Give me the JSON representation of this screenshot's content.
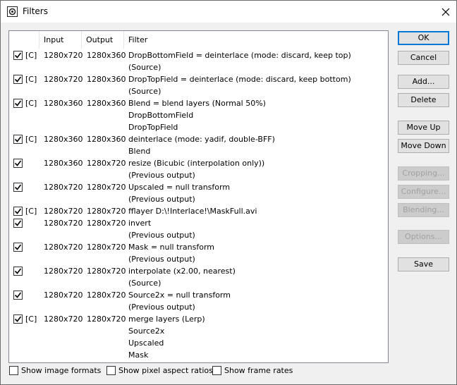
{
  "window": {
    "title": "Filters"
  },
  "columns": {
    "input": "Input",
    "output": "Output",
    "filter": "Filter"
  },
  "rows": [
    {
      "checked": true,
      "tag": "[C]",
      "input": "1280x720",
      "output": "1280x360",
      "lines": [
        "DropBottomField = deinterlace (mode: discard, keep top)",
        "(Source)"
      ]
    },
    {
      "checked": true,
      "tag": "[C]",
      "input": "1280x720",
      "output": "1280x360",
      "lines": [
        "DropTopField = deinterlace (mode: discard, keep bottom)",
        "(Source)"
      ]
    },
    {
      "checked": true,
      "tag": "[C]",
      "input": "1280x360",
      "output": "1280x360",
      "lines": [
        "Blend = blend layers (Normal 50%)",
        "DropBottomField",
        "DropTopField"
      ]
    },
    {
      "checked": true,
      "tag": "[C]",
      "input": "1280x360",
      "output": "1280x360",
      "lines": [
        "deinterlace (mode: yadif, double-BFF)",
        "Blend"
      ]
    },
    {
      "checked": true,
      "tag": "",
      "input": "1280x360",
      "output": "1280x720",
      "lines": [
        "resize (Bicubic (interpolation only))",
        "(Previous output)"
      ]
    },
    {
      "checked": true,
      "tag": "",
      "input": "1280x720",
      "output": "1280x720",
      "lines": [
        "Upscaled = null transform",
        "(Previous output)"
      ]
    },
    {
      "checked": true,
      "tag": "[C]",
      "input": "1280x720",
      "output": "1280x720",
      "lines": [
        "fflayer D:\\!Interlace!\\MaskFull.avi"
      ]
    },
    {
      "checked": true,
      "tag": "",
      "input": "1280x720",
      "output": "1280x720",
      "lines": [
        "invert",
        "(Previous output)"
      ]
    },
    {
      "checked": true,
      "tag": "",
      "input": "1280x720",
      "output": "1280x720",
      "lines": [
        "Mask = null transform",
        "(Previous output)"
      ]
    },
    {
      "checked": true,
      "tag": "",
      "input": "1280x720",
      "output": "1280x720",
      "lines": [
        "interpolate (x2.00, nearest)",
        "(Source)"
      ]
    },
    {
      "checked": true,
      "tag": "",
      "input": "1280x720",
      "output": "1280x720",
      "lines": [
        "Source2x = null transform",
        "(Previous output)"
      ]
    },
    {
      "checked": true,
      "tag": "[C]",
      "input": "1280x720",
      "output": "1280x720",
      "lines": [
        "merge layers (Lerp)",
        "Source2x",
        "Upscaled",
        "Mask"
      ]
    }
  ],
  "buttons": {
    "ok": "OK",
    "cancel": "Cancel",
    "add": "Add...",
    "delete": "Delete",
    "move_up": "Move Up",
    "move_down": "Move Down",
    "cropping": "Cropping...",
    "configure": "Configure...",
    "blending": "Blending...",
    "options": "Options...",
    "save": "Save"
  },
  "options": {
    "show_image_formats": "Show image formats",
    "show_pixel_aspect_ratios": "Show pixel aspect ratios",
    "show_frame_rates": "Show frame rates"
  }
}
